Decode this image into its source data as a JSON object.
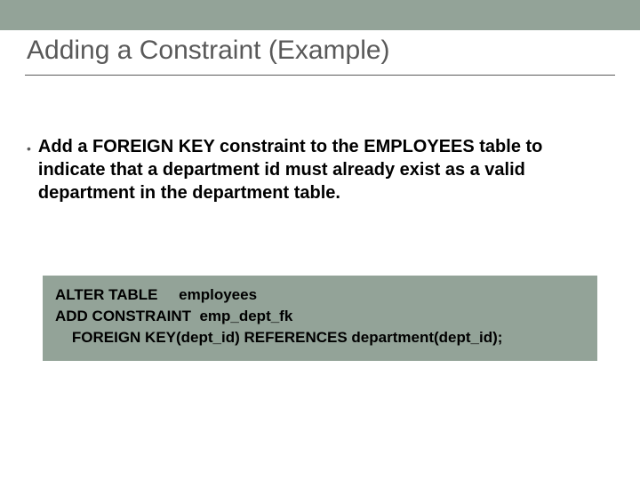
{
  "slide": {
    "title": "Adding a Constraint (Example)",
    "bullets": [
      {
        "text": "Add a FOREIGN KEY constraint to the EMPLOYEES table to indicate that a department id must already exist as a valid department in the department table."
      }
    ],
    "code_block": "ALTER TABLE     employees\nADD CONSTRAINT  emp_dept_fk\n    FOREIGN KEY(dept_id) REFERENCES department(dept_id);"
  }
}
